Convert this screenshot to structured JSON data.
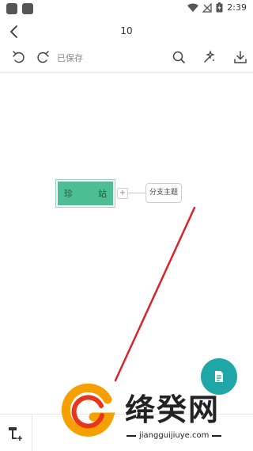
{
  "status_bar": {
    "time": "2:39"
  },
  "title_bar": {
    "title": "10"
  },
  "toolbar": {
    "save_status": "已保存"
  },
  "mindmap": {
    "central_left": "珍",
    "central_right": "站",
    "expand_symbol": "+",
    "branch_label": "分支主题"
  },
  "watermark": {
    "title": "绛癸网",
    "url": "jiangguijiuye.com"
  },
  "icons": {
    "back": "back-arrow-icon",
    "undo": "undo-icon",
    "redo": "redo-icon",
    "search": "search-icon",
    "style": "style-wand-icon",
    "download": "download-icon",
    "fab": "outline-document-icon",
    "add_topic": "add-topic-icon"
  },
  "colors": {
    "central_node": "#4dbe93",
    "fab": "#1fa7a7",
    "annotation_line": "#d8232a"
  }
}
